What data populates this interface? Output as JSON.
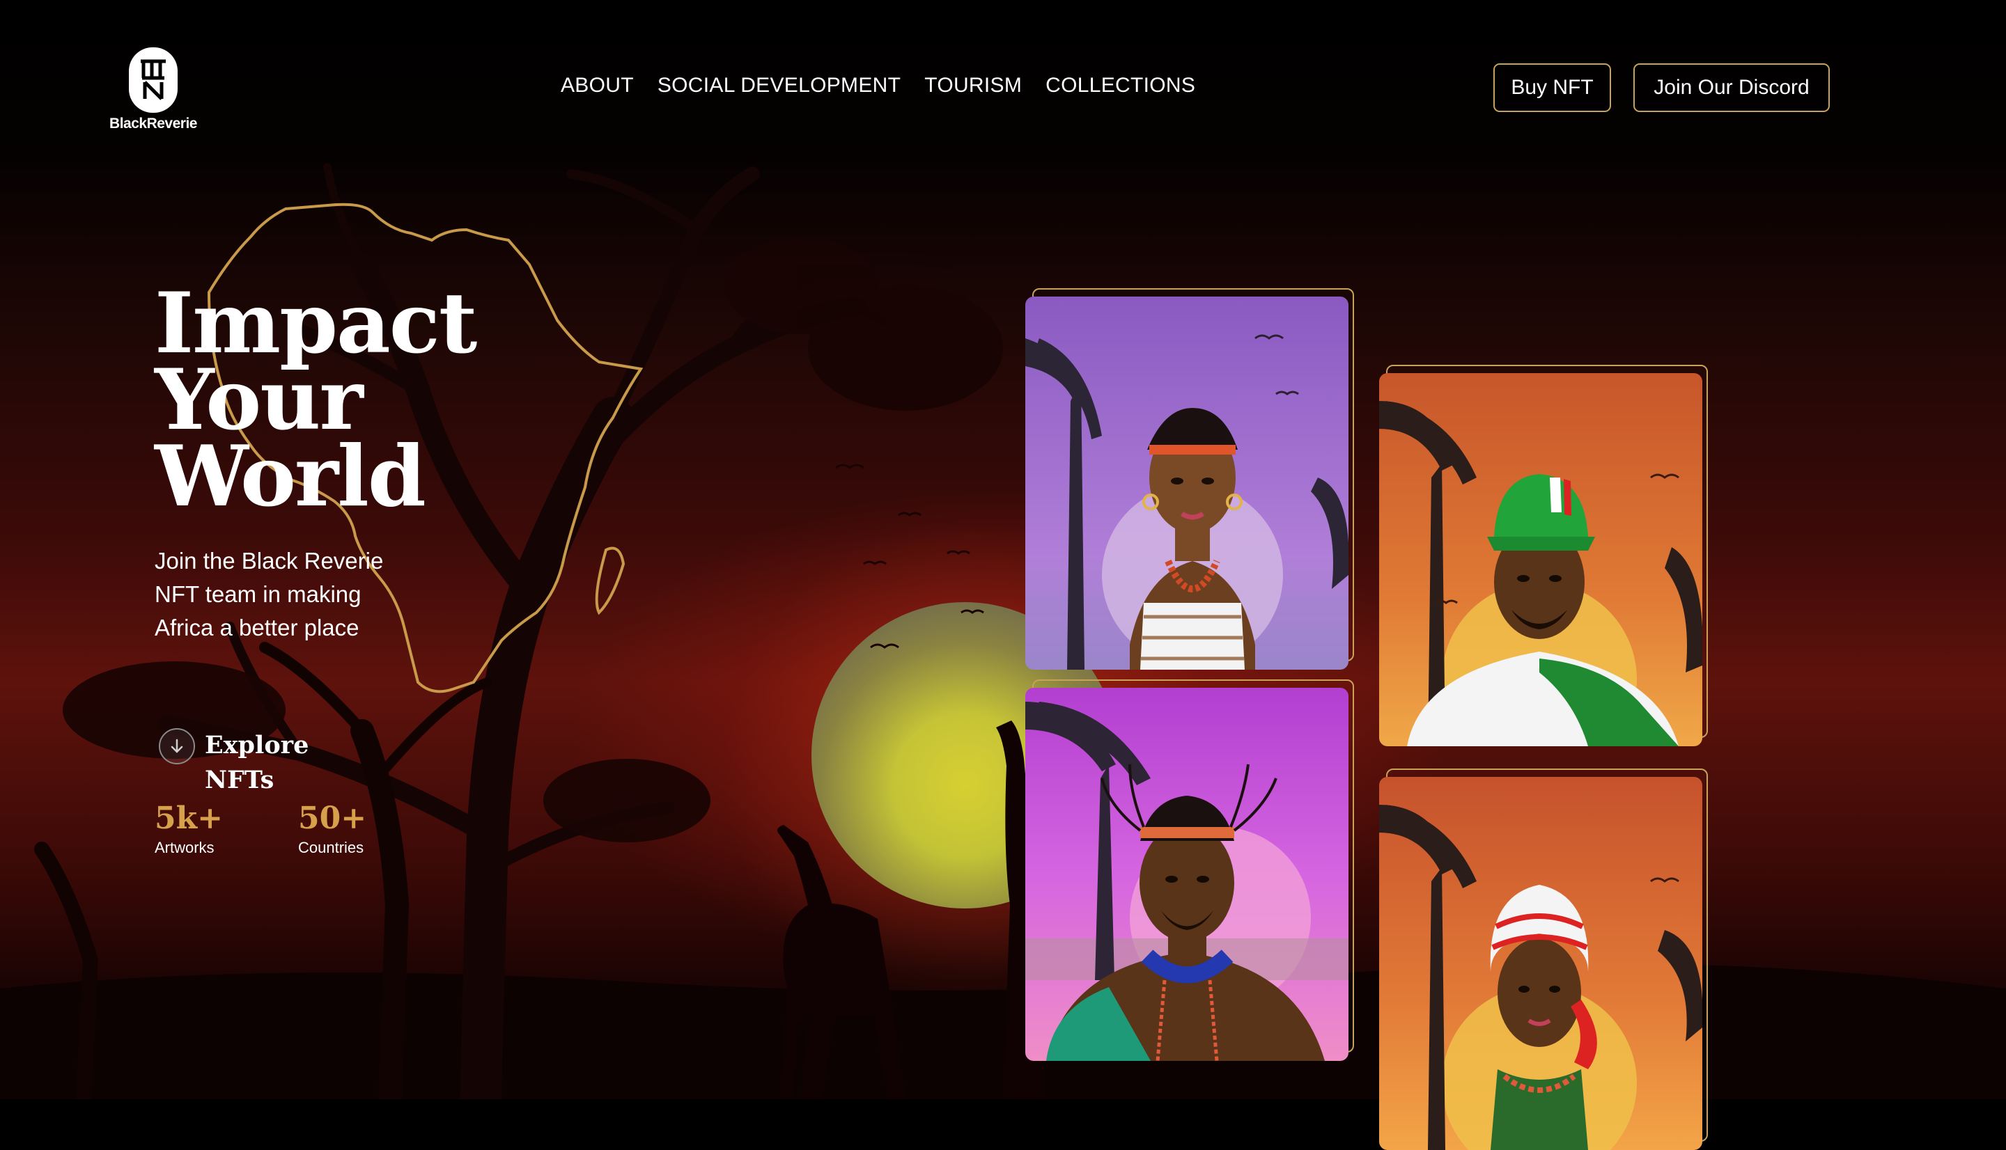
{
  "brand": {
    "name": "BlackReverie"
  },
  "nav": {
    "items": [
      "ABOUT",
      "SOCIAL DEVELOPMENT",
      "TOURISM",
      "COLLECTIONS"
    ]
  },
  "header_buttons": {
    "buy": "Buy NFT",
    "discord": "Join Our Discord"
  },
  "hero": {
    "headline": [
      "Impact",
      "Your",
      "World"
    ],
    "subtext": [
      "Join the Black Reverie",
      "NFT team in making",
      "Africa a better place"
    ],
    "explore": [
      "Explore",
      "NFTs"
    ]
  },
  "stats": [
    {
      "value": "5k+",
      "label": "Artworks"
    },
    {
      "value": "50+",
      "label": "Countries"
    }
  ],
  "nft_cards": [
    {
      "icon": "nft-avatar-purple-woman"
    },
    {
      "icon": "nft-avatar-orange-man-green-cap"
    },
    {
      "icon": "nft-avatar-pink-man-headband"
    },
    {
      "icon": "nft-avatar-orange-woman-headwrap"
    }
  ],
  "colors": {
    "accent_gold": "#d6a14a",
    "button_border": "#c9a25a",
    "background": "#000000"
  }
}
